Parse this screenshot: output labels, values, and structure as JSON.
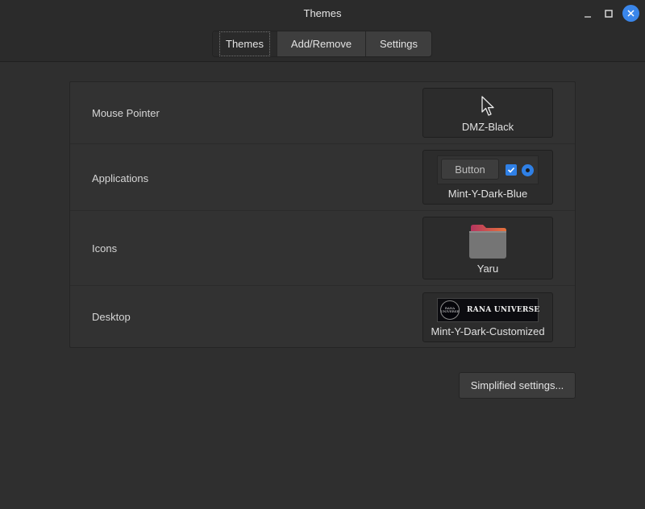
{
  "window": {
    "title": "Themes"
  },
  "tabs": [
    {
      "label": "Themes"
    },
    {
      "label": "Add/Remove"
    },
    {
      "label": "Settings"
    }
  ],
  "rows": {
    "mouse_pointer": {
      "label": "Mouse Pointer",
      "value": "DMZ-Black"
    },
    "applications": {
      "label": "Applications",
      "value": "Mint-Y-Dark-Blue",
      "preview_button": "Button"
    },
    "icons": {
      "label": "Icons",
      "value": "Yaru"
    },
    "desktop": {
      "label": "Desktop",
      "value": "Mint-Y-Dark-Customized",
      "banner_logo": "RANA UNIVERSE",
      "banner_text": "RANA UNIVERSE"
    }
  },
  "footer": {
    "simplified_label": "Simplified settings..."
  },
  "colors": {
    "accent": "#3a86ea",
    "background": "#2f2f2f"
  }
}
